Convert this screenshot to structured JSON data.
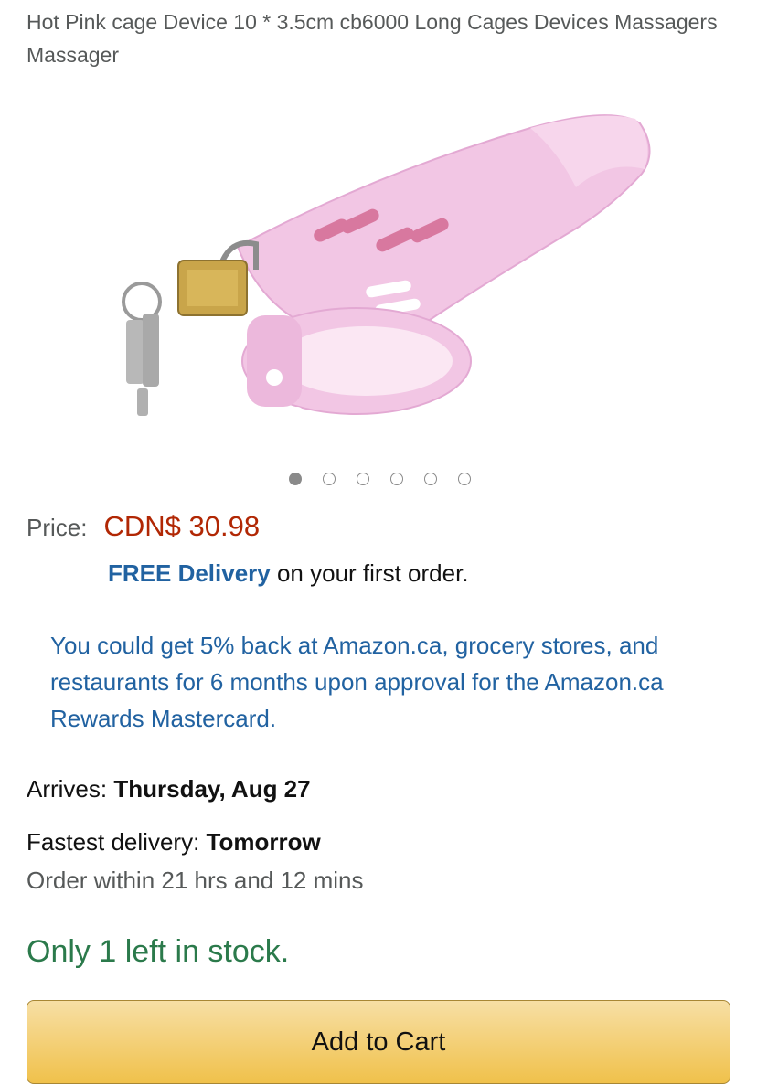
{
  "product": {
    "title": "Hot Pink cage Device 10 * 3.5cm cb6000 Long Cages Devices Massagers Massager",
    "image_count": 6,
    "active_image_index": 0
  },
  "pricing": {
    "price_label": "Price:",
    "price_value": "CDN$ 30.98",
    "free_delivery": "FREE Delivery",
    "delivery_suffix": " on your first order."
  },
  "promo": {
    "rewards_text": "You could get 5% back at Amazon.ca, grocery stores, and restaurants for 6 months upon approval for the Amazon.ca Rewards Mastercard."
  },
  "delivery": {
    "arrives_label": "Arrives: ",
    "arrives_date": "Thursday, Aug 27",
    "fastest_label": "Fastest delivery: ",
    "fastest_value": "Tomorrow",
    "order_within": "Order within 21 hrs and 12 mins"
  },
  "stock": {
    "status": "Only 1 left in stock."
  },
  "actions": {
    "add_to_cart": "Add to Cart"
  },
  "colors": {
    "price": "#b12704",
    "link": "#2162a1",
    "stock": "#2b7a4b",
    "button": "#f0c14b",
    "product_pink": "#f2c6e4"
  }
}
